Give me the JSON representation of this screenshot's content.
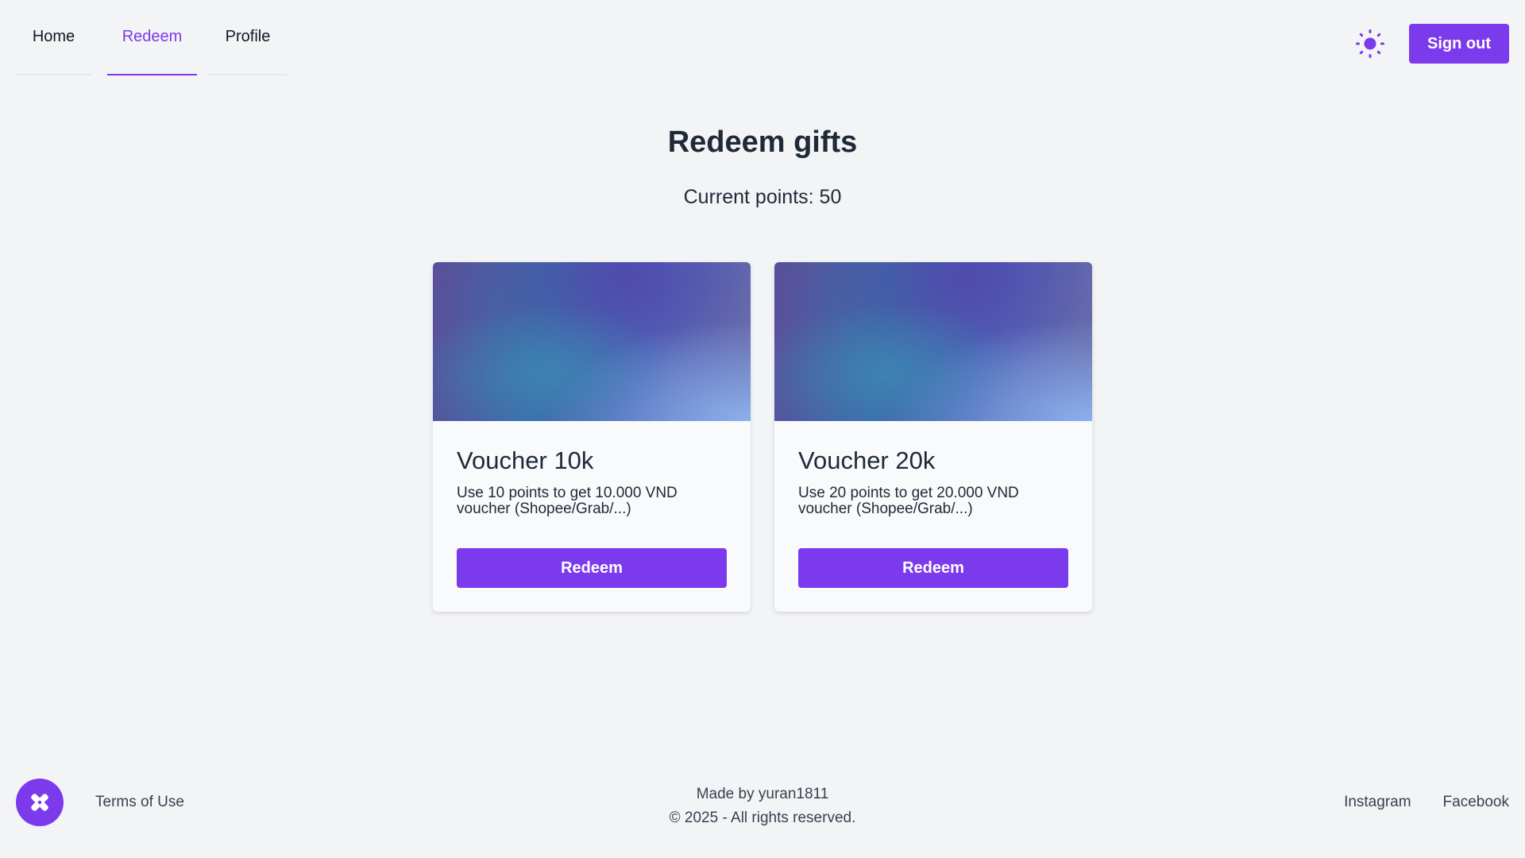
{
  "nav": {
    "tabs": [
      {
        "label": "Home"
      },
      {
        "label": "Redeem",
        "active": true
      },
      {
        "label": "Profile"
      }
    ]
  },
  "header": {
    "theme_icon": "sun-icon",
    "signout_label": "Sign out"
  },
  "main": {
    "title": "Redeem gifts",
    "points_label": "Current points:",
    "points_value": "50"
  },
  "cards": [
    {
      "title": "Voucher 10k",
      "description": "Use 10 points to get 10.000 VND voucher (Shopee/Grab/...)",
      "button_label": "Redeem"
    },
    {
      "title": "Voucher 20k",
      "description": "Use 20 points to get 20.000 VND voucher (Shopee/Grab/...)",
      "button_label": "Redeem"
    }
  ],
  "footer": {
    "logo_icon": "puzzle-logo-icon",
    "terms_label": "Terms of Use",
    "credit_line1": "Made by yuran1811",
    "credit_line2": "© 2025 - All rights reserved.",
    "social": [
      {
        "label": "Instagram"
      },
      {
        "label": "Facebook"
      }
    ]
  },
  "colors": {
    "accent": "#7c3aed",
    "background": "#f3f4f6",
    "card_background": "#f8fafc",
    "text": "#1f2937"
  }
}
